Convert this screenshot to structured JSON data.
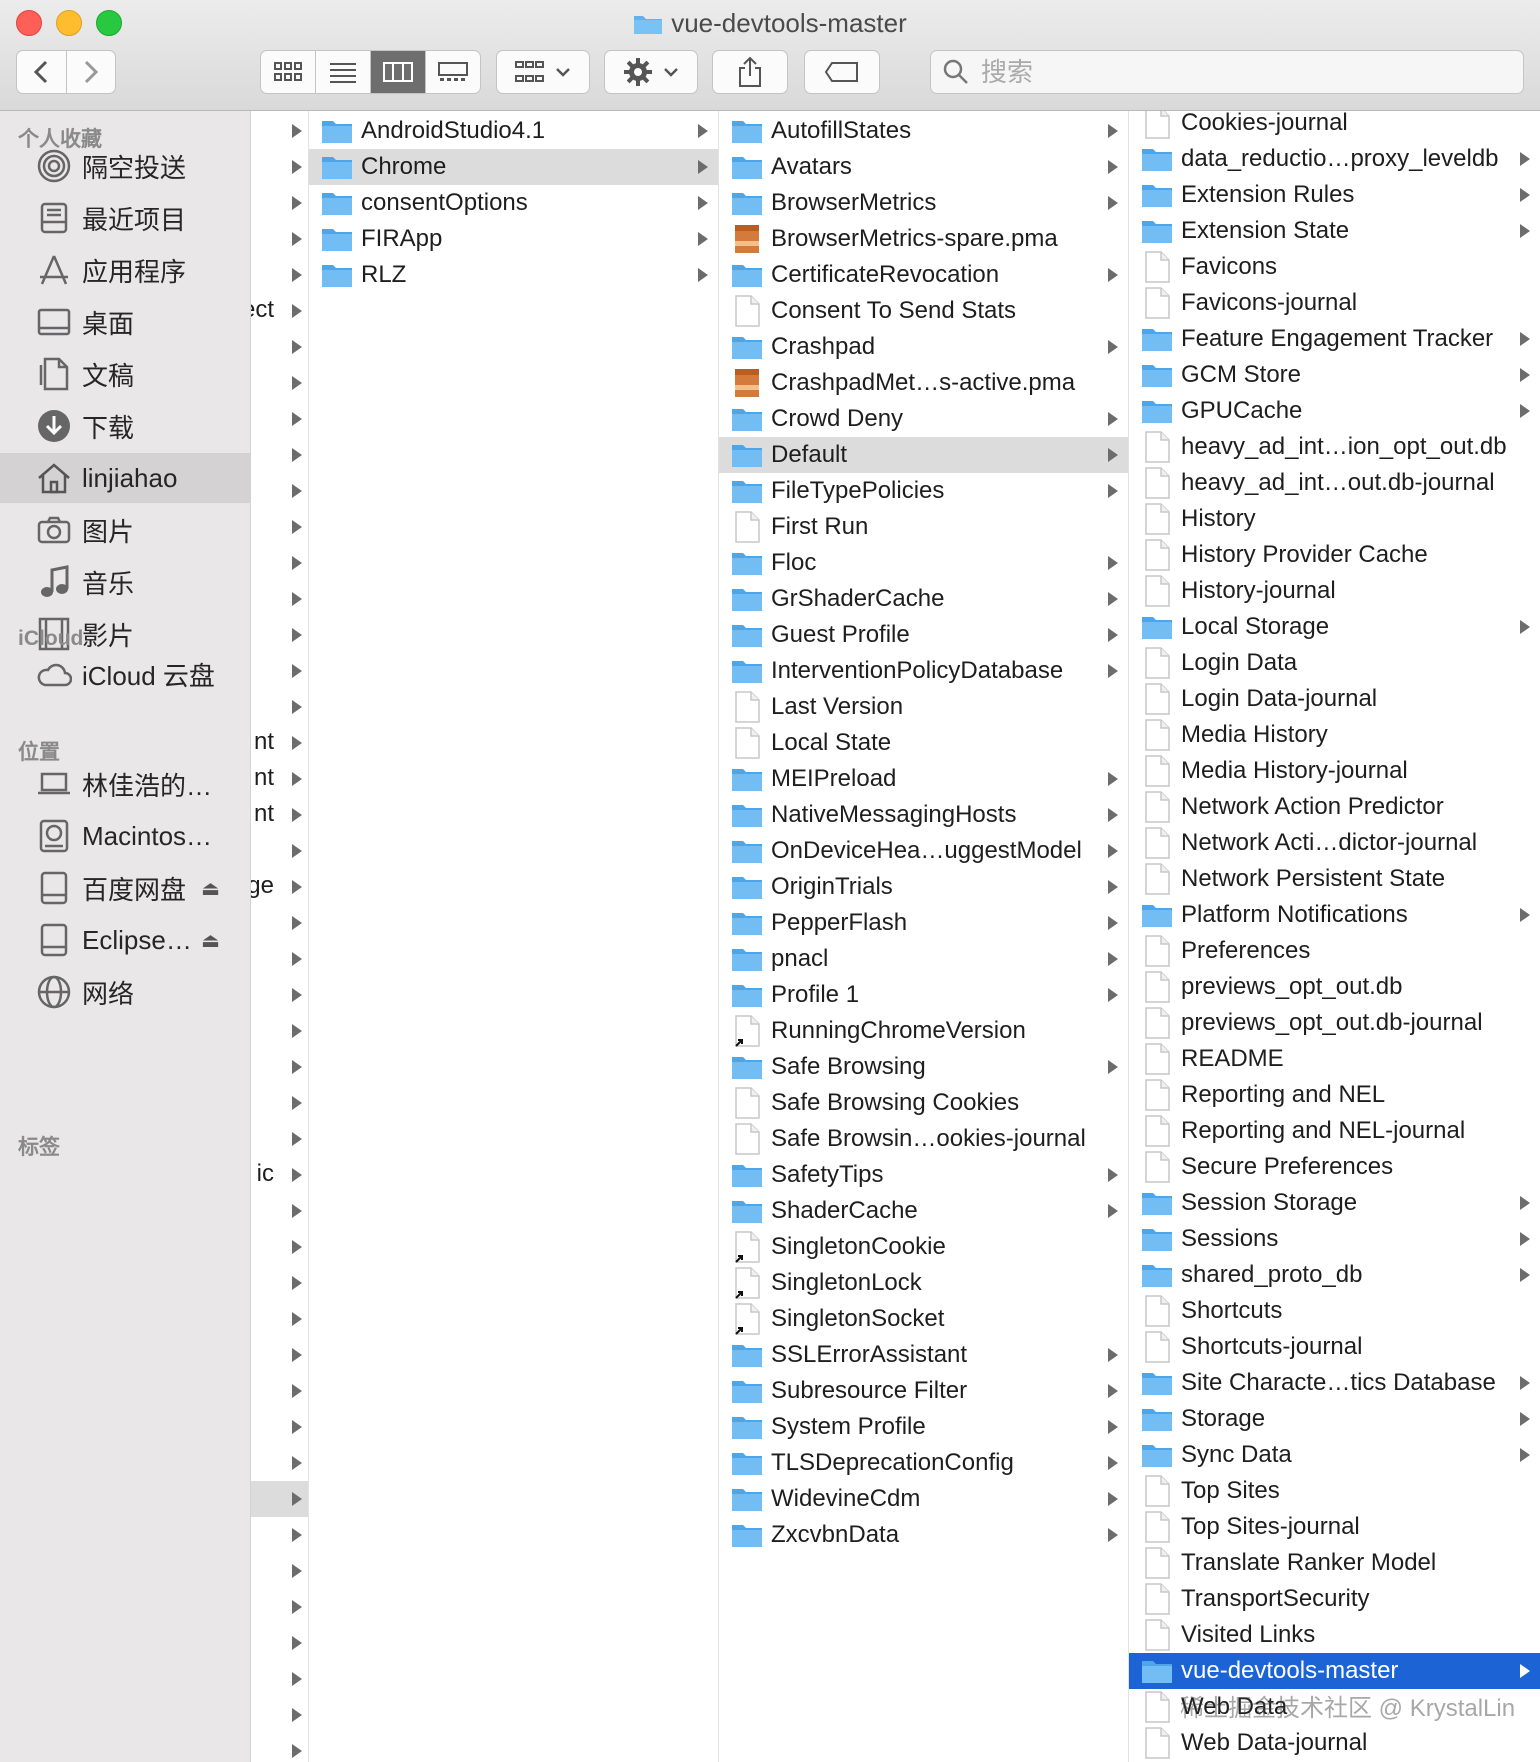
{
  "window": {
    "title": "vue-devtools-master"
  },
  "toolbar": {
    "search_placeholder": "搜索"
  },
  "sidebar": {
    "favorites_header": "个人收藏",
    "favorites": [
      {
        "label": "隔空投送",
        "icon": "airdrop-icon"
      },
      {
        "label": "最近项目",
        "icon": "recents-icon"
      },
      {
        "label": "应用程序",
        "icon": "applications-icon"
      },
      {
        "label": "桌面",
        "icon": "desktop-icon"
      },
      {
        "label": "文稿",
        "icon": "documents-icon"
      },
      {
        "label": "下载",
        "icon": "downloads-icon"
      },
      {
        "label": "linjiahao",
        "icon": "home-icon"
      },
      {
        "label": "图片",
        "icon": "pictures-icon"
      },
      {
        "label": "音乐",
        "icon": "music-icon"
      },
      {
        "label": "影片",
        "icon": "movies-icon"
      }
    ],
    "icloud_header": "iCloud",
    "icloud": [
      {
        "label": "iCloud 云盘",
        "icon": "icloud-icon"
      }
    ],
    "locations_header": "位置",
    "locations": [
      {
        "label": "林佳浩的…",
        "icon": "laptop-icon"
      },
      {
        "label": "Macintos…",
        "icon": "harddisk-icon"
      },
      {
        "label": "百度网盘",
        "icon": "external-disk-icon"
      },
      {
        "label": "Eclipse…",
        "icon": "external-disk-icon"
      },
      {
        "label": "网络",
        "icon": "network-icon"
      }
    ],
    "tags_header": "标签"
  },
  "column0_partial": [
    "ect",
    "nt",
    "nt",
    "nt",
    "ge",
    "ic"
  ],
  "column1": [
    {
      "name": "AndroidStudio4.1",
      "kind": "folder"
    },
    {
      "name": "Chrome",
      "kind": "folder"
    },
    {
      "name": "consentOptions",
      "kind": "folder"
    },
    {
      "name": "FIRApp",
      "kind": "folder"
    },
    {
      "name": "RLZ",
      "kind": "folder"
    }
  ],
  "column2": [
    {
      "name": "AutofillStates",
      "kind": "folder"
    },
    {
      "name": "Avatars",
      "kind": "folder"
    },
    {
      "name": "BrowserMetrics",
      "kind": "folder"
    },
    {
      "name": "BrowserMetrics-spare.pma",
      "kind": "archive"
    },
    {
      "name": "CertificateRevocation",
      "kind": "folder"
    },
    {
      "name": "Consent To Send Stats",
      "kind": "file"
    },
    {
      "name": "Crashpad",
      "kind": "folder"
    },
    {
      "name": "CrashpadMet…s-active.pma",
      "kind": "archive"
    },
    {
      "name": "Crowd Deny",
      "kind": "folder"
    },
    {
      "name": "Default",
      "kind": "folder"
    },
    {
      "name": "FileTypePolicies",
      "kind": "folder"
    },
    {
      "name": "First Run",
      "kind": "file"
    },
    {
      "name": "Floc",
      "kind": "folder"
    },
    {
      "name": "GrShaderCache",
      "kind": "folder"
    },
    {
      "name": "Guest Profile",
      "kind": "folder"
    },
    {
      "name": "InterventionPolicyDatabase",
      "kind": "folder"
    },
    {
      "name": "Last Version",
      "kind": "file"
    },
    {
      "name": "Local State",
      "kind": "file"
    },
    {
      "name": "MEIPreload",
      "kind": "folder"
    },
    {
      "name": "NativeMessagingHosts",
      "kind": "folder"
    },
    {
      "name": "OnDeviceHea…uggestModel",
      "kind": "folder"
    },
    {
      "name": "OriginTrials",
      "kind": "folder"
    },
    {
      "name": "PepperFlash",
      "kind": "folder"
    },
    {
      "name": "pnacl",
      "kind": "folder"
    },
    {
      "name": "Profile 1",
      "kind": "folder"
    },
    {
      "name": "RunningChromeVersion",
      "kind": "alias"
    },
    {
      "name": "Safe Browsing",
      "kind": "folder"
    },
    {
      "name": "Safe Browsing Cookies",
      "kind": "file"
    },
    {
      "name": "Safe Browsin…ookies-journal",
      "kind": "file"
    },
    {
      "name": "SafetyTips",
      "kind": "folder"
    },
    {
      "name": "ShaderCache",
      "kind": "folder"
    },
    {
      "name": "SingletonCookie",
      "kind": "alias"
    },
    {
      "name": "SingletonLock",
      "kind": "alias"
    },
    {
      "name": "SingletonSocket",
      "kind": "alias"
    },
    {
      "name": "SSLErrorAssistant",
      "kind": "folder"
    },
    {
      "name": "Subresource Filter",
      "kind": "folder"
    },
    {
      "name": "System Profile",
      "kind": "folder"
    },
    {
      "name": "TLSDeprecationConfig",
      "kind": "folder"
    },
    {
      "name": "WidevineCdm",
      "kind": "folder"
    },
    {
      "name": "ZxcvbnData",
      "kind": "folder"
    }
  ],
  "column3": [
    {
      "name": "Cookies-journal",
      "kind": "file"
    },
    {
      "name": "data_reductio…proxy_leveldb",
      "kind": "folder"
    },
    {
      "name": "Extension Rules",
      "kind": "folder"
    },
    {
      "name": "Extension State",
      "kind": "folder"
    },
    {
      "name": "Favicons",
      "kind": "file"
    },
    {
      "name": "Favicons-journal",
      "kind": "file"
    },
    {
      "name": "Feature Engagement Tracker",
      "kind": "folder"
    },
    {
      "name": "GCM Store",
      "kind": "folder"
    },
    {
      "name": "GPUCache",
      "kind": "folder"
    },
    {
      "name": "heavy_ad_int…ion_opt_out.db",
      "kind": "file"
    },
    {
      "name": "heavy_ad_int…out.db-journal",
      "kind": "file"
    },
    {
      "name": "History",
      "kind": "file"
    },
    {
      "name": "History Provider Cache",
      "kind": "file"
    },
    {
      "name": "History-journal",
      "kind": "file"
    },
    {
      "name": "Local Storage",
      "kind": "folder"
    },
    {
      "name": "Login Data",
      "kind": "file"
    },
    {
      "name": "Login Data-journal",
      "kind": "file"
    },
    {
      "name": "Media History",
      "kind": "file"
    },
    {
      "name": "Media History-journal",
      "kind": "file"
    },
    {
      "name": "Network Action Predictor",
      "kind": "file"
    },
    {
      "name": "Network Acti…dictor-journal",
      "kind": "file"
    },
    {
      "name": "Network Persistent State",
      "kind": "file"
    },
    {
      "name": "Platform Notifications",
      "kind": "folder"
    },
    {
      "name": "Preferences",
      "kind": "file"
    },
    {
      "name": "previews_opt_out.db",
      "kind": "file"
    },
    {
      "name": "previews_opt_out.db-journal",
      "kind": "file"
    },
    {
      "name": "README",
      "kind": "file"
    },
    {
      "name": "Reporting and NEL",
      "kind": "file"
    },
    {
      "name": "Reporting and NEL-journal",
      "kind": "file"
    },
    {
      "name": "Secure Preferences",
      "kind": "file"
    },
    {
      "name": "Session Storage",
      "kind": "folder"
    },
    {
      "name": "Sessions",
      "kind": "folder"
    },
    {
      "name": "shared_proto_db",
      "kind": "folder"
    },
    {
      "name": "Shortcuts",
      "kind": "file"
    },
    {
      "name": "Shortcuts-journal",
      "kind": "file"
    },
    {
      "name": "Site Characte…tics Database",
      "kind": "folder"
    },
    {
      "name": "Storage",
      "kind": "folder"
    },
    {
      "name": "Sync Data",
      "kind": "folder"
    },
    {
      "name": "Top Sites",
      "kind": "file"
    },
    {
      "name": "Top Sites-journal",
      "kind": "file"
    },
    {
      "name": "Translate Ranker Model",
      "kind": "file"
    },
    {
      "name": "TransportSecurity",
      "kind": "file"
    },
    {
      "name": "Visited Links",
      "kind": "file"
    },
    {
      "name": "vue-devtools-master",
      "kind": "folder"
    },
    {
      "name": "Web Data",
      "kind": "file"
    },
    {
      "name": "Web Data-journal",
      "kind": "file"
    }
  ],
  "selection": {
    "column1": "Chrome",
    "column2": "Default",
    "column3": "vue-devtools-master"
  },
  "watermark": "稀土掘金技术社区 @ KrystalLin",
  "colors": {
    "folder": "#5fb2ee",
    "selection_blue": "#1c64d6",
    "selection_gray": "#dcdcdc",
    "sidebar_bg": "#e9e7e8"
  }
}
